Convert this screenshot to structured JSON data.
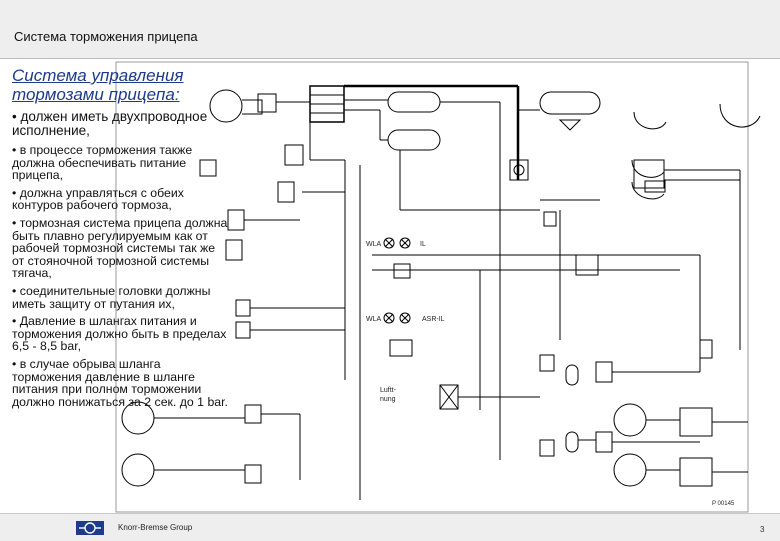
{
  "header": {
    "title": "Система торможения прицепа"
  },
  "content": {
    "heading_line1": "Система управления",
    "heading_line2": "тормозами прицепа:",
    "bullets": [
      "• должен иметь двухпроводное\nисполнение,",
      "• в процессе торможения также\nдолжна обеспечивать питание\nприцепа,",
      "• должна управляться с обеих\nконтуров рабочего тормоза,",
      "• тормозная система прицепа должна\nбыть плавно регулируемым как от\nрабочей тормозной системы так же\nот стояночной тормозной системы\nтягача,",
      "• соединительные головки должны\nиметь защиту от путания их,",
      "• Давление в шлангах питания и\nторможения должно быть в пределах\n6,5 - 8,5 bar,",
      "• в случае обрыва шланга\nторможения давление в шланге\nпитания при полном торможении\nдолжно понижаться за 2 сек. до 1 bar."
    ]
  },
  "diagram": {
    "labels": {
      "wla_1": "WLA",
      "il": "IL",
      "wla_2": "WLA",
      "asr_il": "ASR-IL",
      "lufttrocknung_1": "Luftt-",
      "lufttrocknung_2": "nung",
      "figure_id": "P 00145"
    }
  },
  "footer": {
    "company": "Knorr-Bremse Group",
    "page_number": "3"
  }
}
